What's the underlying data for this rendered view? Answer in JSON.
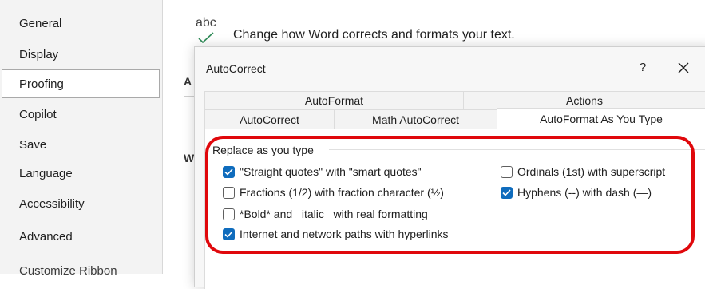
{
  "sidebar": {
    "items": [
      {
        "label": "General"
      },
      {
        "label": "Display"
      },
      {
        "label": "Proofing"
      },
      {
        "label": "Copilot"
      },
      {
        "label": "Save"
      },
      {
        "label": "Language"
      },
      {
        "label": "Accessibility"
      },
      {
        "label": "Advanced"
      },
      {
        "label": "Customize Ribbon"
      }
    ],
    "selected": "Proofing"
  },
  "main": {
    "icon_text": "abc",
    "header": "Change how Word corrects and formats your text.",
    "fragment_a": "A",
    "fragment_w": "W"
  },
  "dialog": {
    "title": "AutoCorrect",
    "help": "?",
    "tabs_row1": [
      "AutoFormat",
      "Actions"
    ],
    "tabs_row2": [
      "AutoCorrect",
      "Math AutoCorrect",
      "AutoFormat As You Type"
    ],
    "active_tab": "AutoFormat As You Type",
    "group_title": "Replace as you type",
    "options": [
      {
        "label": "\"Straight quotes\" with \"smart quotes\"",
        "checked": true
      },
      {
        "label": "Fractions (1/2) with fraction character (½)",
        "checked": false
      },
      {
        "label": "*Bold* and _italic_ with real formatting",
        "checked": false
      },
      {
        "label": "Internet and network paths with hyperlinks",
        "checked": true
      },
      {
        "label": "Ordinals (1st) with superscript",
        "checked": false
      },
      {
        "label": "Hyphens (--) with dash (—)",
        "checked": true
      }
    ]
  },
  "colors": {
    "accent": "#0f6cbd",
    "highlight": "#e0080c"
  }
}
